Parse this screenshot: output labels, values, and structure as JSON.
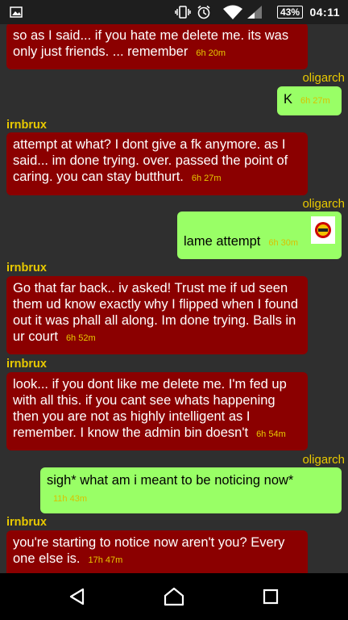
{
  "status_bar": {
    "icons": [
      "image-icon",
      "vibrate-icon",
      "alarm-icon",
      "wifi-icon",
      "signal-icon",
      "battery-icon"
    ],
    "battery": "43%",
    "time": "04:11"
  },
  "messages": [
    {
      "sender": "",
      "text": "so as I said... if you hate me delete me. its was only just friends. ... remember",
      "time": "6h 20m"
    },
    {
      "sender": "oligarch",
      "text": "K",
      "time": "6h 27m"
    },
    {
      "sender": "irnbrux",
      "text": "attempt at what? I dont give a fk anymore. as I said... im done trying. over. passed the point of caring. you can stay butthurt.",
      "time": "6h 27m"
    },
    {
      "sender": "oligarch",
      "text": "lame attempt",
      "time": "6h 30m"
    },
    {
      "sender": "irnbrux",
      "text": "Go that far back.. iv asked! Trust me if ud seen them ud know exactly why I flipped when I found out it was phall all along. Im done trying. Balls in ur court",
      "time": "6h 52m"
    },
    {
      "sender": "irnbrux",
      "text": "look... if you dont like me delete me. I'm fed up with all this. if you cant see whats happening then you are not as highly intelligent as I remember. I know the admin bin doesn't",
      "time": "6h 54m"
    },
    {
      "sender": "oligarch",
      "text": "sigh* what am i meant to be noticing now*",
      "time": "11h 43m"
    },
    {
      "sender": "irnbrux",
      "text": "you're starting to notice now aren't you? Every one else is.",
      "time": "17h 47m"
    }
  ],
  "nav_bar": {
    "icons": [
      "back-icon",
      "home-icon",
      "recents-icon"
    ]
  },
  "colors": {
    "incoming_bubble": "#8b0000",
    "outgoing_bubble": "#99ff66",
    "sender_name": "#e8c900",
    "background": "#2f2f2f"
  }
}
